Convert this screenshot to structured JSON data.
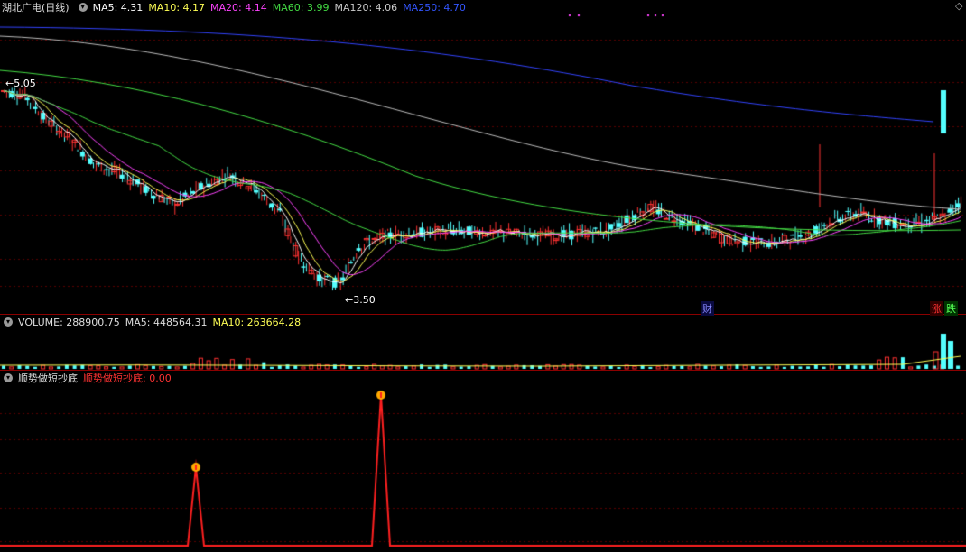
{
  "title": "湖北广电(日线)",
  "ma_labels": [
    {
      "text": "MA5: 4.31",
      "color": "#ffffff"
    },
    {
      "text": "MA10: 4.17",
      "color": "#ffff55"
    },
    {
      "text": "MA20: 4.14",
      "color": "#ff44ff"
    },
    {
      "text": "MA60: 3.99",
      "color": "#44dd44"
    },
    {
      "text": "MA120: 4.06",
      "color": "#cccccc"
    },
    {
      "text": "MA250: 4.70",
      "color": "#3355ff"
    }
  ],
  "price_markers": {
    "high": "5.05",
    "low": "3.50"
  },
  "event_tags": {
    "finance": "财",
    "up": "涨",
    "down": "跌"
  },
  "volume_bar": {
    "label": "VOLUME: 288900.75",
    "ma5": "MA5: 448564.31",
    "ma10": "MA10: 263664.28"
  },
  "indicator_bar": {
    "name": "顺势做短抄底",
    "value_label": "顺势做短抄底: 0.00"
  },
  "colors": {
    "up": "#ff3232",
    "down": "#54ffff",
    "grid": "#8b0000"
  }
}
